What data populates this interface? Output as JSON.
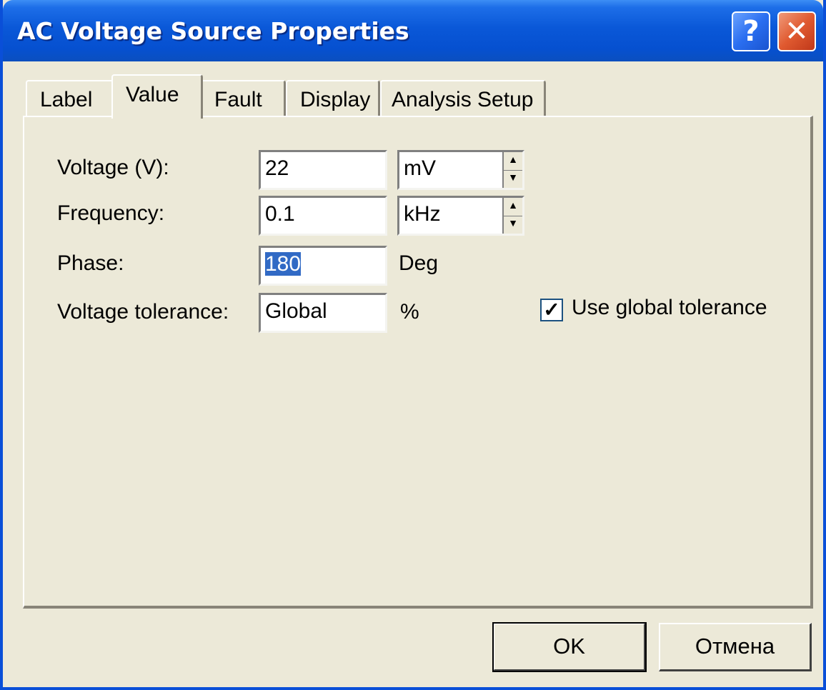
{
  "window": {
    "title": "AC Voltage Source Properties",
    "help_glyph": "?",
    "close_glyph": "✕"
  },
  "tabs": [
    {
      "label": "Label",
      "active": false
    },
    {
      "label": "Value",
      "active": true
    },
    {
      "label": "Fault",
      "active": false
    },
    {
      "label": "Display",
      "active": false
    },
    {
      "label": "Analysis Setup",
      "active": false
    }
  ],
  "fields": {
    "voltage": {
      "label": "Voltage (V):",
      "value": "22",
      "unit": "mV"
    },
    "frequency": {
      "label": "Frequency:",
      "value": "0.1",
      "unit": "kHz"
    },
    "phase": {
      "label": "Phase:",
      "value": "180",
      "unit": "Deg"
    },
    "tolerance": {
      "label": "Voltage tolerance:",
      "value": "Global",
      "unit": "%"
    }
  },
  "checkbox": {
    "label": "Use global tolerance",
    "checked": true,
    "check_glyph": "✓"
  },
  "buttons": {
    "ok": "OK",
    "cancel": "Отмена"
  },
  "colors": {
    "titlebar": "#0a58d8",
    "selection": "#316ac5",
    "dialog_bg": "#ece9d8"
  }
}
